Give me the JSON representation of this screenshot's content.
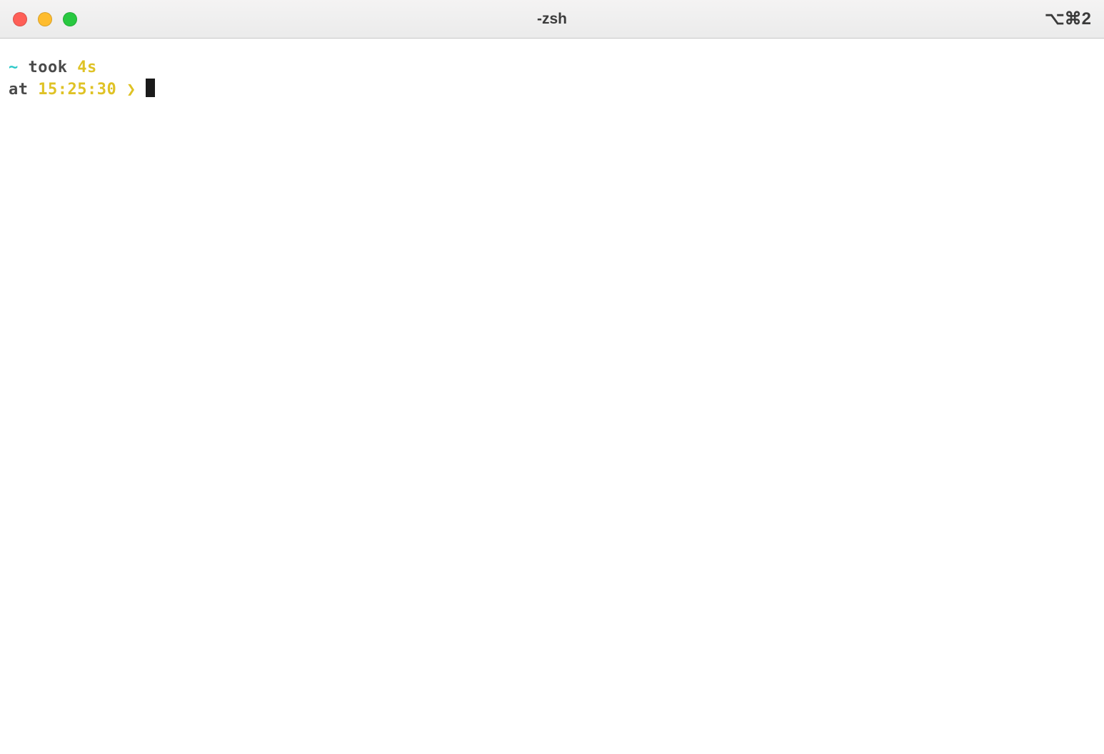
{
  "window": {
    "title": "-zsh",
    "shortcut": "⌥⌘2"
  },
  "prompt": {
    "tilde": "~",
    "took_label": " took ",
    "took_duration": "4s",
    "at_label": "at ",
    "timestamp": "15:25:30",
    "arrow": " ❯ "
  }
}
